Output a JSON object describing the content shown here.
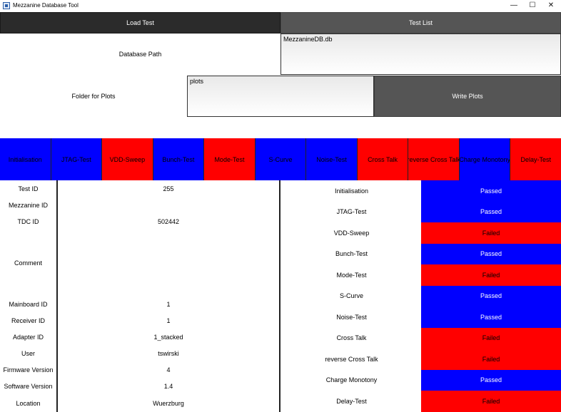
{
  "window": {
    "title": "Mezzanine Database Tool",
    "min": "—",
    "max": "☐",
    "close": "✕"
  },
  "tabs": {
    "load": "Load Test",
    "list": "Test List"
  },
  "db": {
    "label": "Database Path",
    "value": "MezzanineDB.db"
  },
  "plots": {
    "label": "Folder for Plots",
    "value": "plots",
    "button": "Write Plots"
  },
  "colors": {
    "blue": "#0000ff",
    "red": "#ff0000",
    "passed_text": "#ffffff",
    "failed_text": "#000000"
  },
  "tests": [
    {
      "name": "Initialisation",
      "color": "blue"
    },
    {
      "name": "JTAG-Test",
      "color": "blue"
    },
    {
      "name": "VDD-Sweep",
      "color": "red"
    },
    {
      "name": "Bunch-Test",
      "color": "blue"
    },
    {
      "name": "Mode-Test",
      "color": "red"
    },
    {
      "name": "S-Curve",
      "color": "blue"
    },
    {
      "name": "Noise-Test",
      "color": "blue"
    },
    {
      "name": "Cross Talk",
      "color": "red"
    },
    {
      "name": "reverse Cross Talk",
      "color": "red"
    },
    {
      "name": "Charge Monotony",
      "color": "blue"
    },
    {
      "name": "Delay-Test",
      "color": "red"
    }
  ],
  "info": {
    "test_id": {
      "label": "Test ID",
      "value": "255"
    },
    "mezzanine_id": {
      "label": "Mezzanine ID",
      "value": ""
    },
    "tdc_id": {
      "label": "TDC ID",
      "value": "502442"
    },
    "comment": {
      "label": "Comment",
      "value": ""
    },
    "mainboard_id": {
      "label": "Mainboard ID",
      "value": "1"
    },
    "receiver_id": {
      "label": "Receiver ID",
      "value": "1"
    },
    "adapter_id": {
      "label": "Adapter ID",
      "value": "1_stacked"
    },
    "user": {
      "label": "User",
      "value": "tswirski"
    },
    "firmware": {
      "label": "Firmware Version",
      "value": "4"
    },
    "software": {
      "label": "Software Version",
      "value": "1.4"
    },
    "location": {
      "label": "Location",
      "value": "Wuerzburg"
    }
  },
  "results": [
    {
      "name": "Initialisation",
      "status": "Passed"
    },
    {
      "name": "JTAG-Test",
      "status": "Passed"
    },
    {
      "name": "VDD-Sweep",
      "status": "Failed"
    },
    {
      "name": "Bunch-Test",
      "status": "Passed"
    },
    {
      "name": "Mode-Test",
      "status": "Failed"
    },
    {
      "name": "S-Curve",
      "status": "Passed"
    },
    {
      "name": "Noise-Test",
      "status": "Passed"
    },
    {
      "name": "Cross Talk",
      "status": "Failed"
    },
    {
      "name": "reverse Cross Talk",
      "status": "Failed"
    },
    {
      "name": "Charge Monotony",
      "status": "Passed"
    },
    {
      "name": "Delay-Test",
      "status": "Failed"
    }
  ]
}
